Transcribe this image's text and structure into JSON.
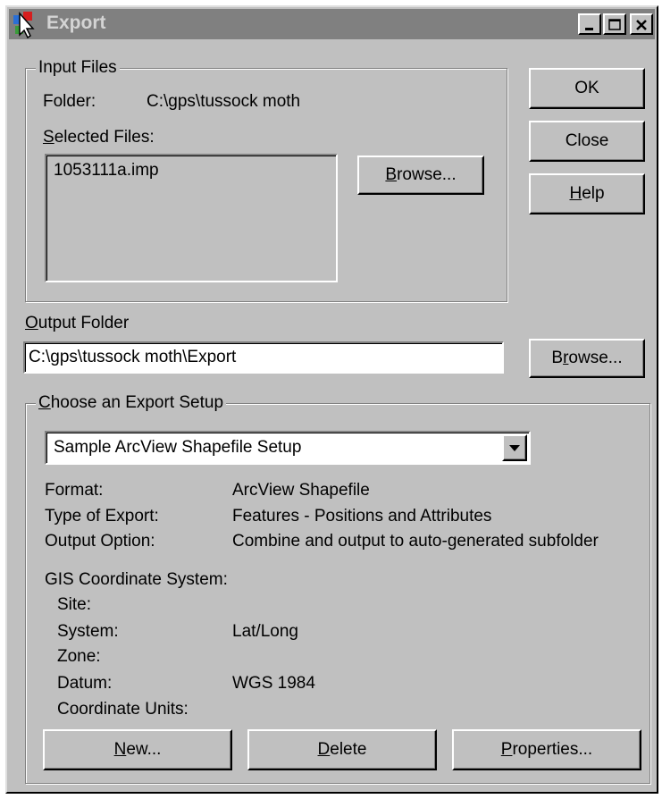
{
  "window": {
    "title": "Export"
  },
  "input_files": {
    "group_label": "Input Files",
    "folder_label": "Folder:",
    "folder_value": "C:\\gps\\tussock moth",
    "selected_files_label_underlined": "S",
    "selected_files_label_rest": "elected Files:",
    "selected_files": [
      "1053111a.imp"
    ],
    "browse_underlined": "B",
    "browse_rest": "rowse..."
  },
  "side_buttons": {
    "ok": "OK",
    "close": "Close",
    "help_underlined": "H",
    "help_rest": "elp"
  },
  "output_folder": {
    "label_underlined": "O",
    "label_rest": "utput Folder",
    "value": "C:\\gps\\tussock moth\\Export",
    "browse_pre": "B",
    "browse_underlined": "r",
    "browse_rest": "owse..."
  },
  "export_setup": {
    "group_label_underlined": "C",
    "group_label_rest": "hoose an Export Setup",
    "selected_setup": "Sample ArcView Shapefile Setup",
    "details": [
      {
        "label": "Format:",
        "value": "ArcView Shapefile"
      },
      {
        "label": "Type of Export:",
        "value": "Features - Positions and Attributes"
      },
      {
        "label": "Output Option:",
        "value": "Combine and output to auto-generated subfolder"
      }
    ],
    "gis_heading": "GIS Coordinate System:",
    "gis": [
      {
        "label": "Site:",
        "value": ""
      },
      {
        "label": "System:",
        "value": "Lat/Long"
      },
      {
        "label": "Zone:",
        "value": ""
      },
      {
        "label": "Datum:",
        "value": "WGS 1984"
      },
      {
        "label": "Coordinate Units:",
        "value": ""
      }
    ],
    "new_underlined": "N",
    "new_rest": "ew...",
    "delete_underlined": "D",
    "delete_rest": "elete",
    "properties_underlined": "P",
    "properties_rest": "roperties..."
  }
}
